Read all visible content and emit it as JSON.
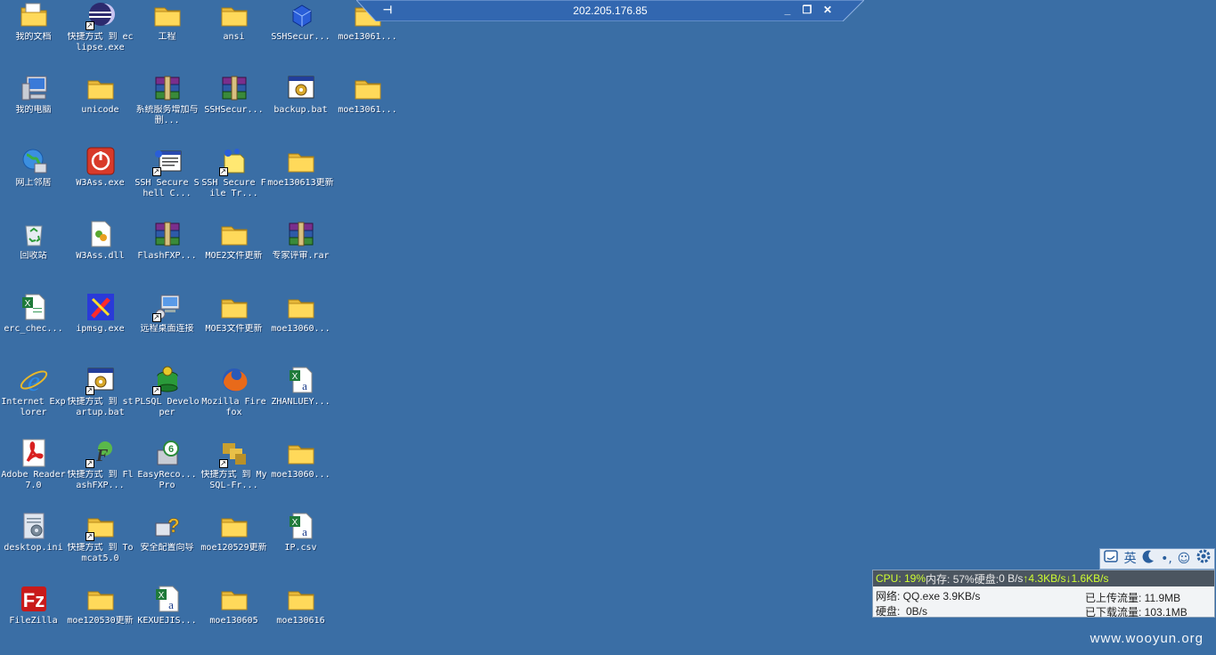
{
  "desktop": {
    "icons": [
      {
        "label": "我的文档",
        "icon": "my-documents-icon"
      },
      {
        "label": "快捷方式 到 eclipse.exe",
        "icon": "eclipse-icon"
      },
      {
        "label": "工程",
        "icon": "folder-icon"
      },
      {
        "label": "ansi",
        "icon": "folder-icon"
      },
      {
        "label": "SSHSecur...",
        "icon": "ssh-package-icon"
      },
      {
        "label": "moe13061...",
        "icon": "folder-icon"
      },
      {
        "label": "我的电脑",
        "icon": "my-computer-icon"
      },
      {
        "label": "unicode",
        "icon": "folder-icon"
      },
      {
        "label": "系统服务增加与删...",
        "icon": "winrar-icon"
      },
      {
        "label": "SSHSecur...",
        "icon": "winrar-icon"
      },
      {
        "label": "backup.bat",
        "icon": "batch-file-icon"
      },
      {
        "label": "moe13061...",
        "icon": "folder-icon"
      },
      {
        "label": "网上邻居",
        "icon": "network-places-icon"
      },
      {
        "label": "W3Ass.exe",
        "icon": "power-app-icon"
      },
      {
        "label": "SSH Secure Shell C...",
        "icon": "ssh-shell-icon"
      },
      {
        "label": "SSH Secure File Tr...",
        "icon": "ssh-file-transfer-icon"
      },
      {
        "label": "moe130613更新",
        "icon": "folder-icon"
      },
      {
        "label": "回收站",
        "icon": "recycle-bin-icon"
      },
      {
        "label": "W3Ass.dll",
        "icon": "dll-file-icon"
      },
      {
        "label": "FlashFXP...",
        "icon": "winrar-icon"
      },
      {
        "label": "MOE2文件更新",
        "icon": "folder-icon"
      },
      {
        "label": "专家评审.rar",
        "icon": "winrar-icon"
      },
      {
        "label": "erc_chec...",
        "icon": "excel-file-icon"
      },
      {
        "label": "ipmsg.exe",
        "icon": "ipmsg-icon"
      },
      {
        "label": "远程桌面连接",
        "icon": "remote-desktop-icon"
      },
      {
        "label": "MOE3文件更新",
        "icon": "folder-icon"
      },
      {
        "label": "moe13060...",
        "icon": "folder-icon"
      },
      {
        "label": "Internet Explorer",
        "icon": "internet-explorer-icon"
      },
      {
        "label": "快捷方式 到 startup.bat",
        "icon": "batch-file-icon"
      },
      {
        "label": "PLSQL Developer",
        "icon": "plsql-icon"
      },
      {
        "label": "Mozilla Firefox",
        "icon": "firefox-icon"
      },
      {
        "label": "ZHANLUEY...",
        "icon": "csv-file-icon"
      },
      {
        "label": "Adobe Reader 7.0",
        "icon": "adobe-reader-icon"
      },
      {
        "label": "快捷方式 到 FlashFXP...",
        "icon": "flashfxp-icon"
      },
      {
        "label": "EasyReco... Pro",
        "icon": "easyrecovery-icon"
      },
      {
        "label": "快捷方式 到 MySQL-Fr...",
        "icon": "mysql-icon"
      },
      {
        "label": "moe13060...",
        "icon": "folder-icon"
      },
      {
        "label": "desktop.ini",
        "icon": "ini-file-icon"
      },
      {
        "label": "快捷方式 到 Tomcat5.0",
        "icon": "folder-icon"
      },
      {
        "label": "安全配置向导",
        "icon": "security-wizard-icon"
      },
      {
        "label": "moe120529更新",
        "icon": "folder-icon"
      },
      {
        "label": "IP.csv",
        "icon": "csv-file-icon"
      },
      {
        "label": "FileZilla",
        "icon": "filezilla-icon"
      },
      {
        "label": "moe120530更新",
        "icon": "folder-icon"
      },
      {
        "label": "KEXUEJIS...",
        "icon": "csv-file-icon"
      },
      {
        "label": "moe130605",
        "icon": "folder-icon"
      },
      {
        "label": "moe130616",
        "icon": "folder-icon"
      }
    ]
  },
  "rdp_bar": {
    "title": "202.205.176.85",
    "pin": "⊣",
    "minimize": "_",
    "restore": "❐",
    "close": "✕"
  },
  "ime_bar": {
    "items": [
      {
        "icon": "ime-logo-icon",
        "text": ""
      },
      {
        "icon": "english-mode-icon",
        "text": "英"
      },
      {
        "icon": "half-width-moon-icon",
        "text": ""
      },
      {
        "icon": "punctuation-icon",
        "text": "•,"
      },
      {
        "icon": "smiley-icon",
        "text": "☺"
      },
      {
        "icon": "settings-gear-icon",
        "text": ""
      }
    ]
  },
  "monitor": {
    "cpu": "CPU: 19%",
    "mem": "内存: 57%",
    "disk_label": "硬盘:",
    "disk_val": "0 B/s",
    "up_arrow": "↑",
    "upload_rate": "4.3KB/s",
    "down_arrow": "↓",
    "download_rate": "1.6KB/s",
    "net_line": "网络: QQ.exe 3.9KB/s",
    "disk_line": "硬盘:  0B/s",
    "uploaded": "已上传流量: 11.9MB",
    "downloaded": "已下载流量: 103.1MB",
    "colors": {
      "top_bg": "#4b5560",
      "value_green": "#d0ff30"
    }
  },
  "watermark": "www.wooyun.org",
  "colors": {
    "desktop": "#3a6ea5",
    "rdp_bar": "#3267b0"
  }
}
